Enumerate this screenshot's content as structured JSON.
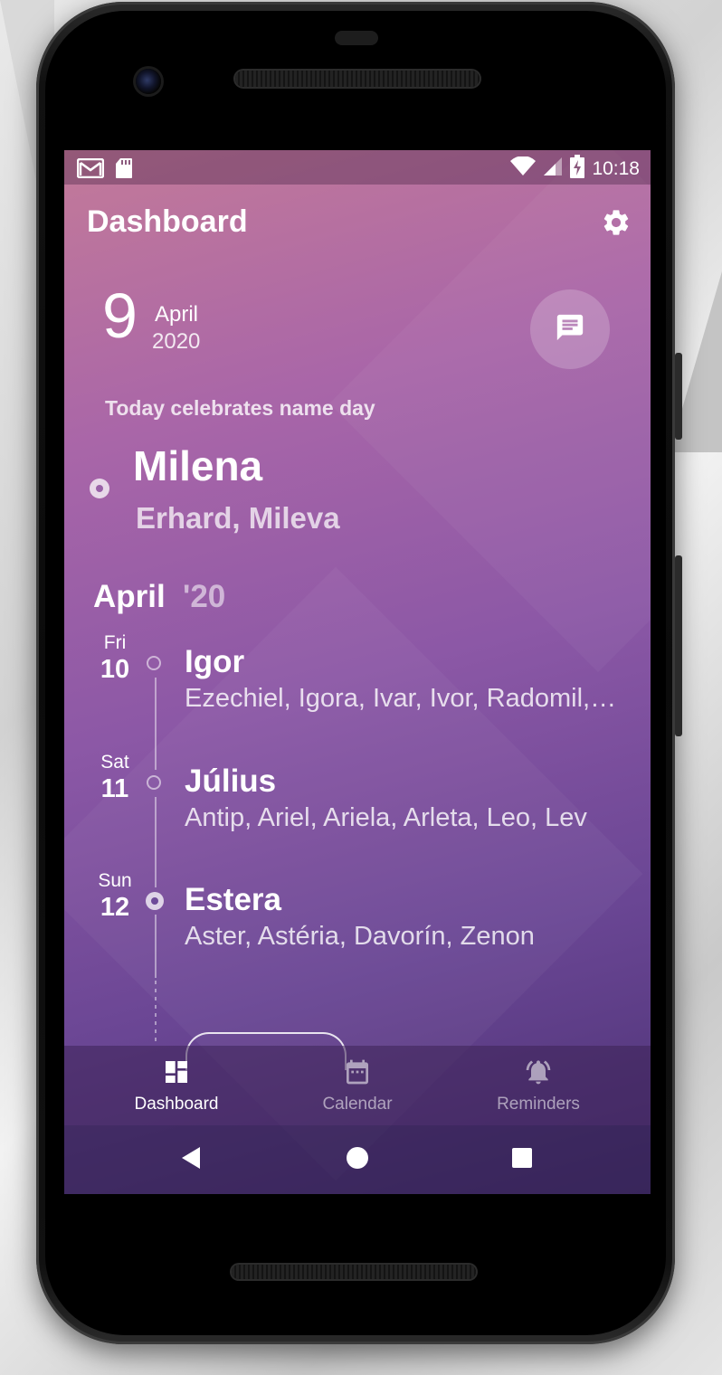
{
  "status_bar": {
    "time": "10:18",
    "left_icons": [
      "gmail-icon",
      "sd-card-icon"
    ],
    "right_icons": [
      "wifi-icon",
      "signal-icon",
      "battery-charging-icon"
    ]
  },
  "app_bar": {
    "title": "Dashboard",
    "settings_icon": "gear-icon"
  },
  "date": {
    "day": "9",
    "month": "April",
    "year": "2020"
  },
  "message_button_icon": "message-icon",
  "today": {
    "label": "Today celebrates name day",
    "main_name": "Milena",
    "other_names": "Erhard, Mileva"
  },
  "month_section": {
    "month": "April",
    "year": "'20"
  },
  "timeline": [
    {
      "day_of_week": "Fri",
      "day": "10",
      "main_name": "Igor",
      "other_names": "Ezechiel, Igora, Ivar, Ivor, Radomil,…"
    },
    {
      "day_of_week": "Sat",
      "day": "11",
      "main_name": "Július",
      "other_names": "Antip, Ariel, Ariela, Arleta, Leo, Lev"
    },
    {
      "day_of_week": "Sun",
      "day": "12",
      "main_name": "Estera",
      "other_names": "Aster, Astéria, Davorín, Zenon"
    }
  ],
  "bottom_nav": [
    {
      "label": "Dashboard",
      "icon": "dashboard-icon",
      "active": true
    },
    {
      "label": "Calendar",
      "icon": "calendar-icon",
      "active": false
    },
    {
      "label": "Reminders",
      "icon": "alarm-icon",
      "active": false
    }
  ],
  "system_nav": [
    "back-icon",
    "home-icon",
    "recents-icon"
  ],
  "colors": {
    "gradient_top": "#c37a99",
    "gradient_bottom": "#4a3173"
  }
}
